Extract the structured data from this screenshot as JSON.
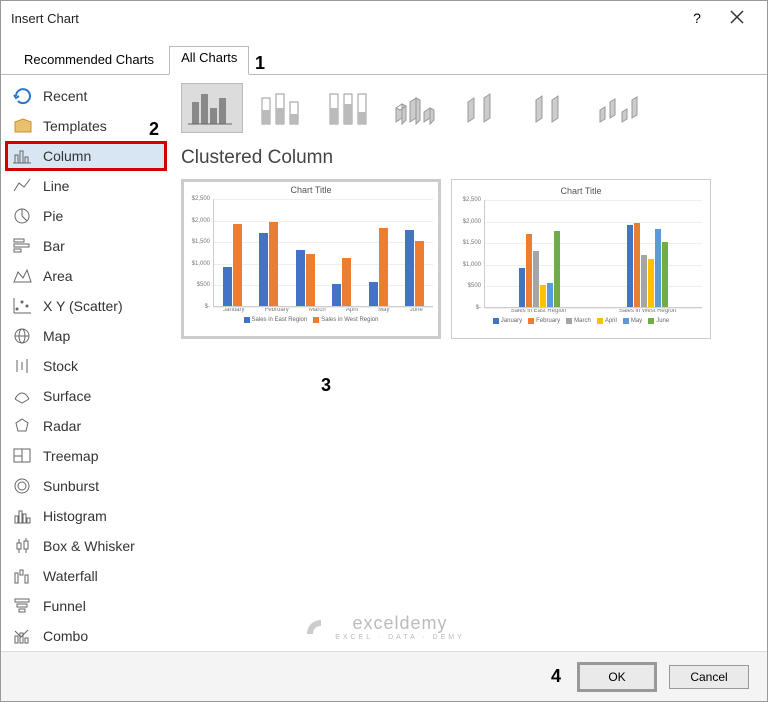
{
  "dialog": {
    "title": "Insert Chart",
    "help_label": "?",
    "tabs": {
      "recommended": "Recommended Charts",
      "all": "All Charts"
    }
  },
  "sidebar": {
    "items": [
      {
        "label": "Recent"
      },
      {
        "label": "Templates"
      },
      {
        "label": "Column"
      },
      {
        "label": "Line"
      },
      {
        "label": "Pie"
      },
      {
        "label": "Bar"
      },
      {
        "label": "Area"
      },
      {
        "label": "X Y (Scatter)"
      },
      {
        "label": "Map"
      },
      {
        "label": "Stock"
      },
      {
        "label": "Surface"
      },
      {
        "label": "Radar"
      },
      {
        "label": "Treemap"
      },
      {
        "label": "Sunburst"
      },
      {
        "label": "Histogram"
      },
      {
        "label": "Box & Whisker"
      },
      {
        "label": "Waterfall"
      },
      {
        "label": "Funnel"
      },
      {
        "label": "Combo"
      }
    ]
  },
  "main": {
    "chart_name": "Clustered Column",
    "preview1_title": "Chart Title",
    "preview2_title": "Chart Title",
    "preview1_legend": [
      "Sales in East Region",
      "Sales in West Region"
    ],
    "preview2_legend": [
      "January",
      "February",
      "March",
      "April",
      "May",
      "June"
    ],
    "preview2_xcats": [
      "Sales in East Region",
      "Sales in West Region"
    ]
  },
  "footer": {
    "ok": "OK",
    "cancel": "Cancel"
  },
  "steps": {
    "s1": "1",
    "s2": "2",
    "s3": "3",
    "s4": "4"
  },
  "watermark": {
    "name": "exceldemy",
    "tag": "EXCEL · DATA · DEMY"
  },
  "chart_data": {
    "type": "bar",
    "title": "Chart Title",
    "categories": [
      "January",
      "February",
      "March",
      "April",
      "May",
      "June"
    ],
    "series": [
      {
        "name": "Sales in East Region",
        "values": [
          900,
          1700,
          1300,
          500,
          550,
          1750
        ],
        "color": "#4472C4"
      },
      {
        "name": "Sales in West Region",
        "values": [
          1900,
          1950,
          1200,
          1100,
          1800,
          1500
        ],
        "color": "#ED7D31"
      }
    ],
    "ylim": [
      0,
      2500
    ],
    "ytick": 500,
    "ylabels": [
      "$-",
      "$500",
      "$1,000",
      "$1,500",
      "$2,000",
      "$2,500"
    ],
    "preview2": {
      "categories": [
        "Sales in East Region",
        "Sales in West Region"
      ],
      "series": [
        {
          "name": "January",
          "values": [
            900,
            1900
          ],
          "color": "#4472C4"
        },
        {
          "name": "February",
          "values": [
            1700,
            1950
          ],
          "color": "#ED7D31"
        },
        {
          "name": "March",
          "values": [
            1300,
            1200
          ],
          "color": "#A5A5A5"
        },
        {
          "name": "April",
          "values": [
            500,
            1100
          ],
          "color": "#FFC000"
        },
        {
          "name": "May",
          "values": [
            550,
            1800
          ],
          "color": "#5B9BD5"
        },
        {
          "name": "June",
          "values": [
            1750,
            1500
          ],
          "color": "#70AD47"
        }
      ],
      "ylim": [
        0,
        2500
      ]
    }
  }
}
